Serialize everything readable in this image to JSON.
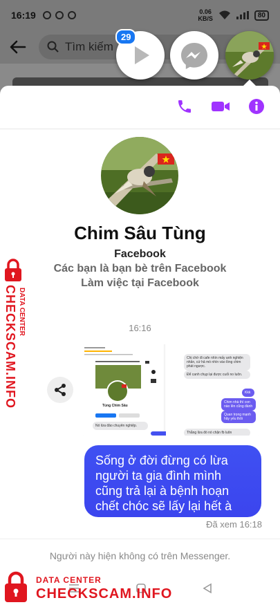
{
  "status_bar": {
    "time": "16:19",
    "network_speed": "0.06",
    "network_unit": "KB/S",
    "battery": "80"
  },
  "search": {
    "placeholder": "Tìm kiếm"
  },
  "chat_heads": {
    "badge_count": "29"
  },
  "profile": {
    "name": "Chim Sâu Tùng",
    "line1": "Facebook",
    "line2": "Các bạn là bạn bè trên Facebook",
    "line3": "Làm việc tại Facebook"
  },
  "conversation": {
    "timestamp": "16:16",
    "message": "Sống ở đời đừng có lừa người ta gia đình mình cũng trả lại à bệnh hoạn chết chóc sẽ lấy lại hết à",
    "seen": "Đã xem 16:18"
  },
  "notice": "Người này hiện không có trên Messenger.",
  "screenshot_preview": {
    "profile_name": "Tùng Chim Sâu",
    "left_caption": "Nó lừa đảo chuyên nghiệp.",
    "bubbles_gray": [
      "Chị chờ đi cafe nhìn mấy anh nghiện nhân, cứ hả mò nhìn vào lồng chim phát ngược.",
      "Để canh chụp lại được cuối no luôn."
    ],
    "bubbles_purple": [
      "Kkk",
      "Chim nhà thì con nào lên cũng đánh",
      "Quan trọng mạnh hãy yếu thôi"
    ],
    "bottom_gray": "Thằng lừa đó nó chặn fb luôn"
  },
  "watermark": {
    "small": "DATA CENTER",
    "big": "CHECKSCAM.INFO"
  },
  "colors": {
    "accent": "#a033ff",
    "bubble": "#3d4af0",
    "watermark": "#e0161f"
  }
}
